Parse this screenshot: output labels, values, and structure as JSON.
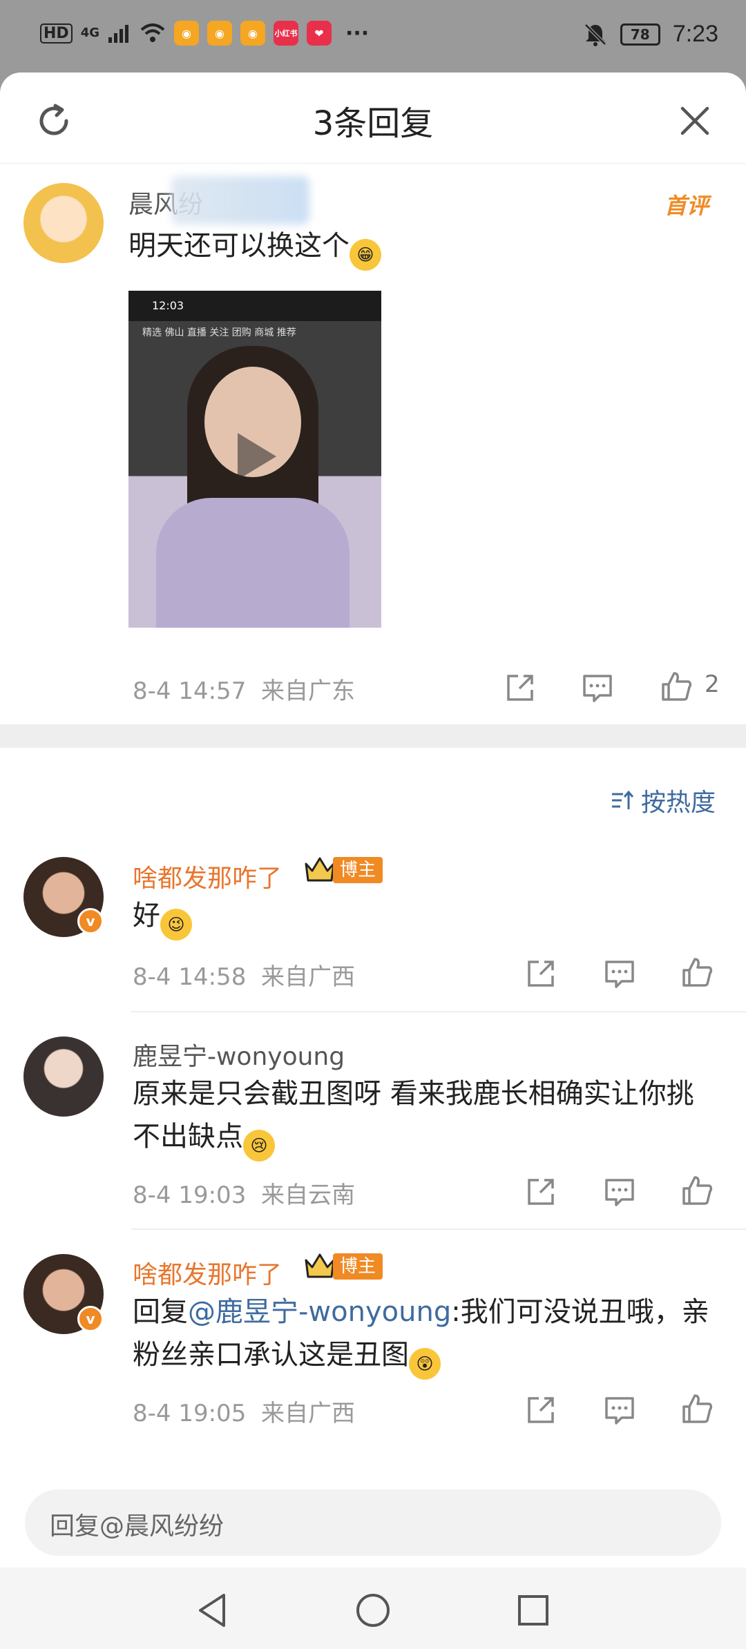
{
  "status_bar": {
    "hd": "HD",
    "network": "4G",
    "time": "7:23",
    "battery": "78",
    "more": "···",
    "app_icons": [
      {
        "name": "weibo-app-icon",
        "label": "",
        "color": "#f5a623"
      },
      {
        "name": "weibo-app-icon",
        "label": "",
        "color": "#f5a623"
      },
      {
        "name": "weibo-app-icon",
        "label": "",
        "color": "#f5a623"
      },
      {
        "name": "xiaohongshu-app-icon",
        "label": "小红书",
        "color": "#e8304b"
      },
      {
        "name": "app-icon",
        "label": "",
        "color": "#e8304b"
      }
    ]
  },
  "header": {
    "title": "3条回复"
  },
  "main_comment": {
    "username": "晨风纷",
    "first_badge": "首评",
    "text": "明天还可以换这个",
    "media_status_time": "12:03",
    "media_tabs": "精选 佛山 直播 关注 团购 商城 推荐",
    "time": "8-4 14:57",
    "location": "来自广东",
    "like_count": "2"
  },
  "sort": {
    "label": "按热度"
  },
  "replies": [
    {
      "username": "啥都发那咋了",
      "badge": "博主",
      "text": "好",
      "time": "8-4 14:58",
      "location": "来自广西"
    },
    {
      "username": "鹿昱宁-wonyoung",
      "text": "原来是只会截丑图呀 看来我鹿长相确实让你挑不出缺点",
      "time": "8-4 19:03",
      "location": "来自云南"
    },
    {
      "username": "啥都发那咋了",
      "badge": "博主",
      "reply_prefix": "回复",
      "mention": "@鹿昱宁-wonyoung",
      "text": ":我们可没说丑哦，亲粉丝亲口承认这是丑图",
      "time": "8-4 19:05",
      "location": "来自广西"
    }
  ],
  "reply_input": {
    "placeholder": "回复@晨风纷纷"
  },
  "colors": {
    "accent_orange": "#e8762d",
    "link_blue": "#3e6b9f",
    "badge_orange": "#f08a24"
  }
}
